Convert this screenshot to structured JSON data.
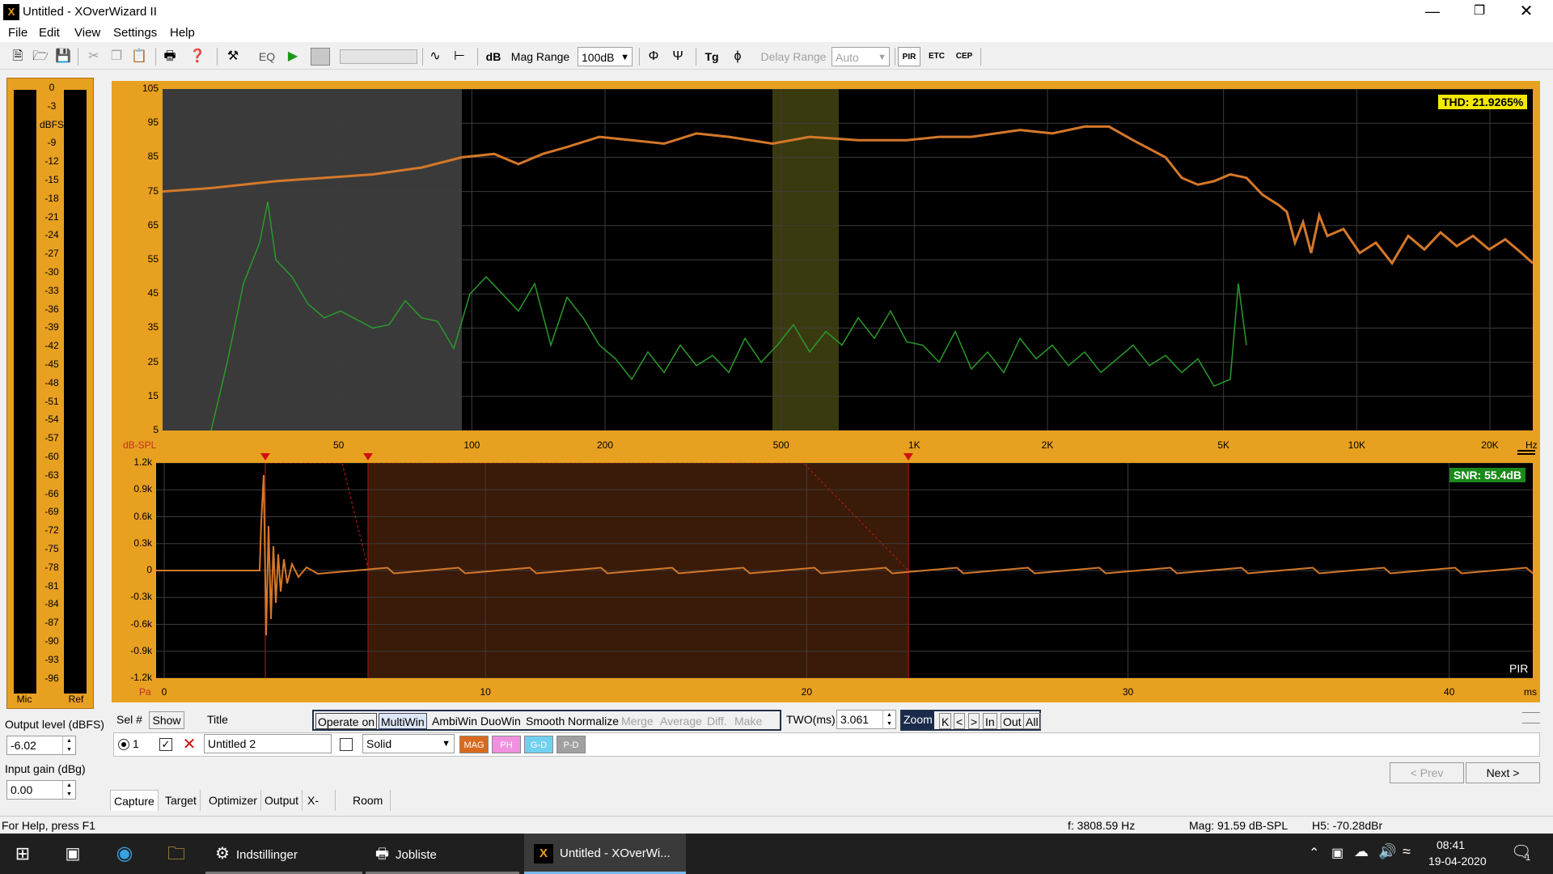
{
  "window": {
    "title": "Untitled - XOverWizard II",
    "icon_text": "X"
  },
  "menu": [
    "File",
    "Edit",
    "View",
    "Settings",
    "Help"
  ],
  "toolbar": {
    "eq": "EQ",
    "db": "dB",
    "mag_range_label": "Mag Range",
    "mag_range_value": "100dB",
    "delay_range_label": "Delay Range",
    "delay_range_value": "Auto",
    "tg": "Tg",
    "pir": "PIR",
    "etc": "ETC",
    "cep": "CEP"
  },
  "meter": {
    "labels": [
      "0",
      "-3",
      "dBFS",
      "-9",
      "-12",
      "-15",
      "-18",
      "-21",
      "-24",
      "-27",
      "-30",
      "-33",
      "-36",
      "-39",
      "-42",
      "-45",
      "-48",
      "-51",
      "-54",
      "-57",
      "-60",
      "-63",
      "-66",
      "-69",
      "-72",
      "-75",
      "-78",
      "-81",
      "-84",
      "-87",
      "-90",
      "-93",
      "-96"
    ],
    "mic": "Mic",
    "ref": "Ref"
  },
  "output_level": {
    "label": "Output level (dBFS)",
    "value": "-6.02"
  },
  "input_gain": {
    "label": "Input gain (dBg)",
    "value": "0.00"
  },
  "mag_plot": {
    "y_ticks": [
      "105",
      "95",
      "85",
      "75",
      "65",
      "55",
      "45",
      "35",
      "25",
      "15",
      "5"
    ],
    "y_unit": "dB-SPL",
    "x_ticks": [
      "50",
      "100",
      "200",
      "500",
      "1K",
      "2K",
      "5K",
      "10K",
      "20K"
    ],
    "x_unit": "Hz",
    "thd": "THD: 21.9265%",
    "colors": {
      "response": "#d4782a",
      "distortion": "#2a9a2a",
      "bg": "#000000",
      "panel": "#e8a020"
    }
  },
  "imp_plot": {
    "y_ticks": [
      "1.2k",
      "0.9k",
      "0.6k",
      "0.3k",
      "0",
      "-0.3k",
      "-0.6k",
      "-0.9k",
      "-1.2k"
    ],
    "y_unit": "Pa",
    "x_ticks": [
      "0",
      "10",
      "20",
      "30",
      "40"
    ],
    "x_unit": "ms",
    "snr": "SNR: 55.4dB",
    "mode": "PIR"
  },
  "controls": {
    "sel_label": "Sel #",
    "show_label": "Show",
    "title_label": "Title",
    "operate_on": "Operate on",
    "ops": [
      "MultiWin",
      "AmbiWin",
      "DuoWin",
      "Smooth",
      "Normalize",
      "Merge",
      "Average",
      "Diff.",
      "Make XO"
    ],
    "two_label": "TWO(ms)",
    "two_value": "3.061",
    "zoom": [
      "Zoom",
      "K",
      "<",
      ">",
      "In",
      "Out",
      "All"
    ],
    "row_num": "1",
    "row_title": "Untitled 2",
    "line_style": "Solid",
    "tags": [
      "MAG",
      "PH",
      "G-D",
      "P-D"
    ],
    "prev": "< Prev",
    "next": "Next >"
  },
  "tabs": [
    "Capture",
    "Target",
    "Optimizer",
    "Output",
    "X-Over",
    "Room Modes"
  ],
  "status": {
    "help": "For Help, press F1",
    "freq": "f: 3808.59 Hz",
    "mag": "Mag: 91.59 dB-SPL",
    "h5": "H5: -70.28dBr"
  },
  "taskbar": {
    "items": [
      "Indstillinger",
      "Jobliste",
      "Untitled - XOverWi..."
    ],
    "time": "08:41",
    "date": "19-04-2020",
    "notif_count": "1"
  }
}
